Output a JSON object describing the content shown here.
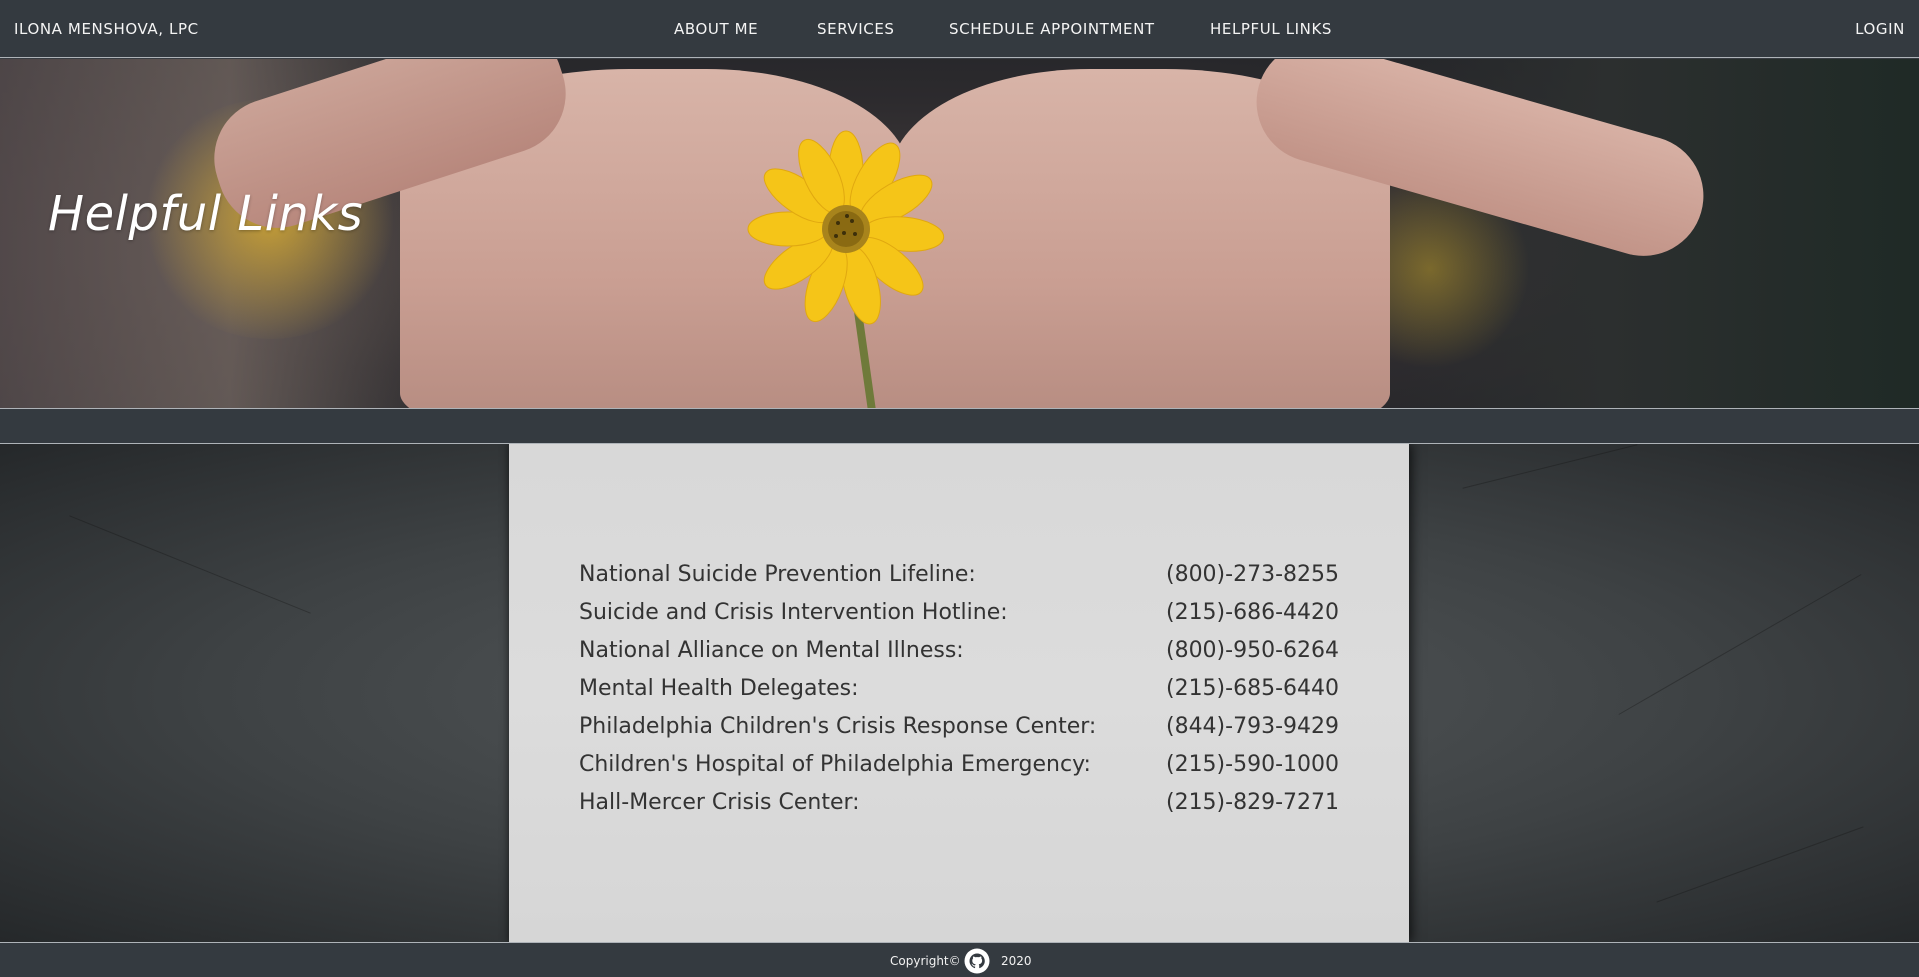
{
  "nav": {
    "brand": "ILONA MENSHOVA, LPC",
    "items": [
      {
        "label": "ABOUT ME"
      },
      {
        "label": "SERVICES"
      },
      {
        "label": "SCHEDULE APPOINTMENT"
      },
      {
        "label": "HELPFUL LINKS"
      }
    ],
    "login": "LOGIN"
  },
  "hero": {
    "title": "Helpful Links"
  },
  "links": [
    {
      "name": "National Suicide Prevention Lifeline:",
      "phone": "(800)-273-8255"
    },
    {
      "name": "Suicide and Crisis Intervention Hotline:",
      "phone": "(215)-686-4420"
    },
    {
      "name": "National Alliance on Mental Illness:",
      "phone": "(800)-950-6264"
    },
    {
      "name": "Mental Health Delegates:",
      "phone": "(215)-685-6440"
    },
    {
      "name": "Philadelphia Children's Crisis Response Center:",
      "phone": "(844)-793-9429"
    },
    {
      "name": "Children's Hospital of Philadelphia Emergency:",
      "phone": "(215)-590-1000"
    },
    {
      "name": "Hall-Mercer Crisis Center:",
      "phone": "(215)-829-7271"
    }
  ],
  "footer": {
    "copyright": "Copyright©",
    "icon": "github-icon",
    "year": "2020"
  },
  "colors": {
    "navbar": "#343a40",
    "card": "#d8d8d8",
    "text": "#333333",
    "flower": "#f5c518"
  }
}
